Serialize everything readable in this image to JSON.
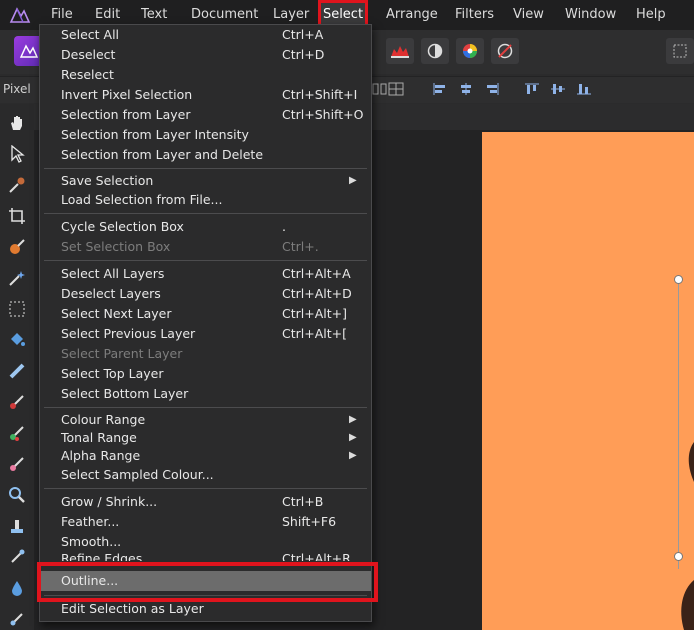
{
  "menubar": {
    "items": [
      "File",
      "Edit",
      "Text",
      "Document",
      "Layer",
      "Select",
      "Arrange",
      "Filters",
      "View",
      "Window",
      "Help"
    ],
    "active": "Select"
  },
  "toolbar": {
    "context_label": "Pixel"
  },
  "select_menu": {
    "items": [
      {
        "label": "Select All",
        "shortcut": "Ctrl+A"
      },
      {
        "label": "Deselect",
        "shortcut": "Ctrl+D"
      },
      {
        "label": "Reselect",
        "shortcut": ""
      },
      {
        "label": "Invert Pixel Selection",
        "shortcut": "Ctrl+Shift+I"
      },
      {
        "label": "Selection from Layer",
        "shortcut": "Ctrl+Shift+O"
      },
      {
        "label": "Selection from Layer Intensity",
        "shortcut": ""
      },
      {
        "label": "Selection from Layer and Delete",
        "shortcut": ""
      },
      {
        "label": "Save Selection",
        "shortcut": "",
        "submenu": true
      },
      {
        "label": "Load Selection from File...",
        "shortcut": ""
      },
      {
        "label": "Cycle Selection Box",
        "shortcut": "."
      },
      {
        "label": "Set Selection Box",
        "shortcut": "Ctrl+.",
        "disabled": true
      },
      {
        "label": "Select All Layers",
        "shortcut": "Ctrl+Alt+A"
      },
      {
        "label": "Deselect Layers",
        "shortcut": "Ctrl+Alt+D"
      },
      {
        "label": "Select Next Layer",
        "shortcut": "Ctrl+Alt+]"
      },
      {
        "label": "Select Previous Layer",
        "shortcut": "Ctrl+Alt+["
      },
      {
        "label": "Select Parent Layer",
        "shortcut": "",
        "disabled": true
      },
      {
        "label": "Select Top Layer",
        "shortcut": ""
      },
      {
        "label": "Select Bottom Layer",
        "shortcut": ""
      },
      {
        "label": "Colour Range",
        "shortcut": "",
        "submenu": true
      },
      {
        "label": "Tonal Range",
        "shortcut": "",
        "submenu": true
      },
      {
        "label": "Alpha Range",
        "shortcut": "",
        "submenu": true
      },
      {
        "label": "Select Sampled Colour...",
        "shortcut": ""
      },
      {
        "label": "Grow / Shrink...",
        "shortcut": "Ctrl+B"
      },
      {
        "label": "Feather...",
        "shortcut": "Shift+F6"
      },
      {
        "label": "Smooth...",
        "shortcut": ""
      },
      {
        "label": "Refine Edges...",
        "shortcut": "Ctrl+Alt+R"
      },
      {
        "label": "Outline...",
        "shortcut": "",
        "highlighted": true
      },
      {
        "label": "Edit Selection as Layer",
        "shortcut": ""
      }
    ]
  },
  "colors": {
    "highlight_red": "#e0141d",
    "canvas_orange": "#ff9d57",
    "menu_bg": "#2b2b2c",
    "hover_bg": "#6c6c6c"
  },
  "tools": [
    "hand-icon",
    "move-icon",
    "color-picker-icon",
    "crop-icon",
    "selection-brush-icon",
    "magic-wand-icon",
    "marquee-icon",
    "flood-fill-icon",
    "gradient-icon",
    "paint-brush-icon",
    "color-replace-icon",
    "erase-brush-icon",
    "zoom-icon",
    "clone-icon",
    "smudge-icon",
    "blur-icon",
    "dodge-icon"
  ]
}
